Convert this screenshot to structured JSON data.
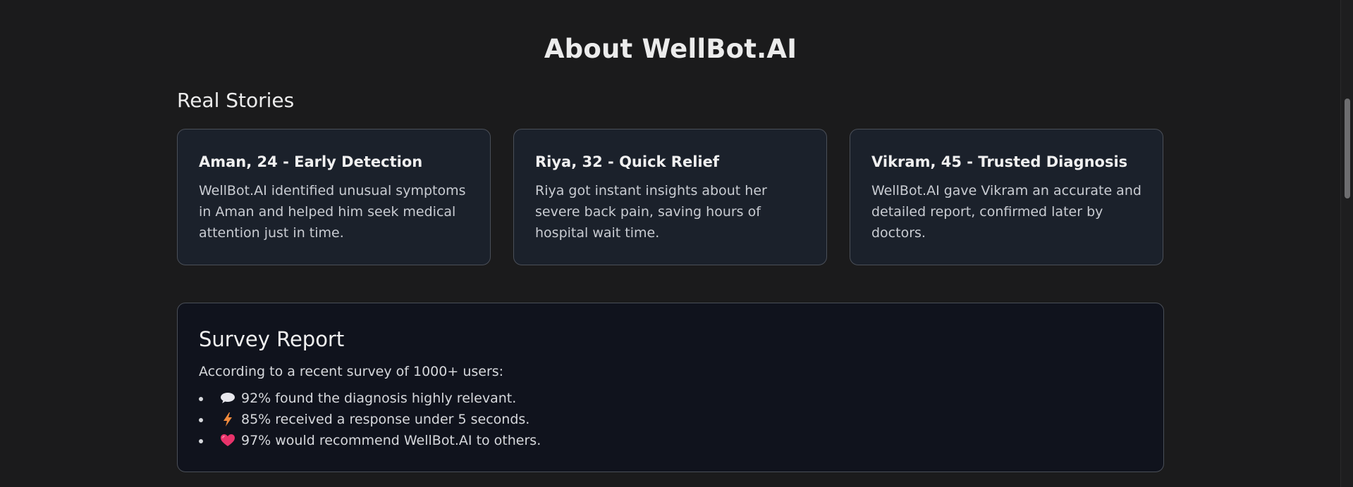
{
  "page": {
    "title": "About WellBot.AI"
  },
  "stories": {
    "heading": "Real Stories",
    "items": [
      {
        "title": "Aman, 24 - Early Detection",
        "text": "WellBot.AI identified unusual symptoms in Aman and helped him seek medical attention just in time."
      },
      {
        "title": "Riya, 32 - Quick Relief",
        "text": "Riya got instant insights about her severe back pain, saving hours of hospital wait time."
      },
      {
        "title": "Vikram, 45 - Trusted Diagnosis",
        "text": "WellBot.AI gave Vikram an accurate and detailed report, confirmed later by doctors."
      }
    ]
  },
  "survey": {
    "heading": "Survey Report",
    "intro": "According to a recent survey of 1000+ users:",
    "items": [
      {
        "icon": "speech-bubble-icon",
        "text": "92% found the diagnosis highly relevant."
      },
      {
        "icon": "lightning-icon",
        "text": "85% received a response under 5 seconds."
      },
      {
        "icon": "heart-icon",
        "text": "97% would recommend WellBot.AI to others."
      }
    ]
  },
  "colors": {
    "background": "#1b1b1c",
    "card_background": "#1b212b",
    "survey_background": "#10131d",
    "border": "#4a4f58",
    "lightning": "#f08a3c",
    "heart": "#e8336b"
  }
}
